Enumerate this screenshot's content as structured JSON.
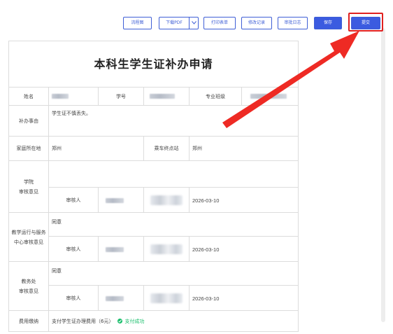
{
  "toolbar": {
    "flowchart": "流程图",
    "download_pdf": "下载PDF",
    "print_form": "打印表单",
    "edit_record": "修改记录",
    "audit_log": "审批日志",
    "save": "保存",
    "submit": "提交"
  },
  "form": {
    "title": "本科生学生证补办申请",
    "row1": {
      "name_label": "姓名",
      "student_id_label": "学号",
      "major_class_label": "专业班级"
    },
    "reason": {
      "label": "补办事由",
      "value": "学生证不慎丢失。"
    },
    "home": {
      "label": "家庭所在地",
      "value": "郑州",
      "station_label": "乘车终点站",
      "station_value": "郑州"
    },
    "college": {
      "label_line1": "学院",
      "label_line2": "审核意见",
      "opinion": "",
      "reviewer_label": "审核人",
      "date": "2026-03-10"
    },
    "teaching": {
      "label_line1": "教学运行与服务",
      "label_line2": "中心审核意见",
      "opinion": "同意",
      "reviewer_label": "审核人",
      "date": "2026-03-10"
    },
    "academic": {
      "label_line1": "教务处",
      "label_line2": "审核意见",
      "opinion": "同意",
      "reviewer_label": "审核人",
      "date": "2026-03-10"
    },
    "fee": {
      "label": "费用缴纳",
      "value": "支付学生证办理费用（6元）",
      "status": "支付成功"
    }
  },
  "colors": {
    "primary": "#3b5be0",
    "highlight": "#e02020",
    "success": "#19be6b",
    "border": "#dcdcdc"
  }
}
